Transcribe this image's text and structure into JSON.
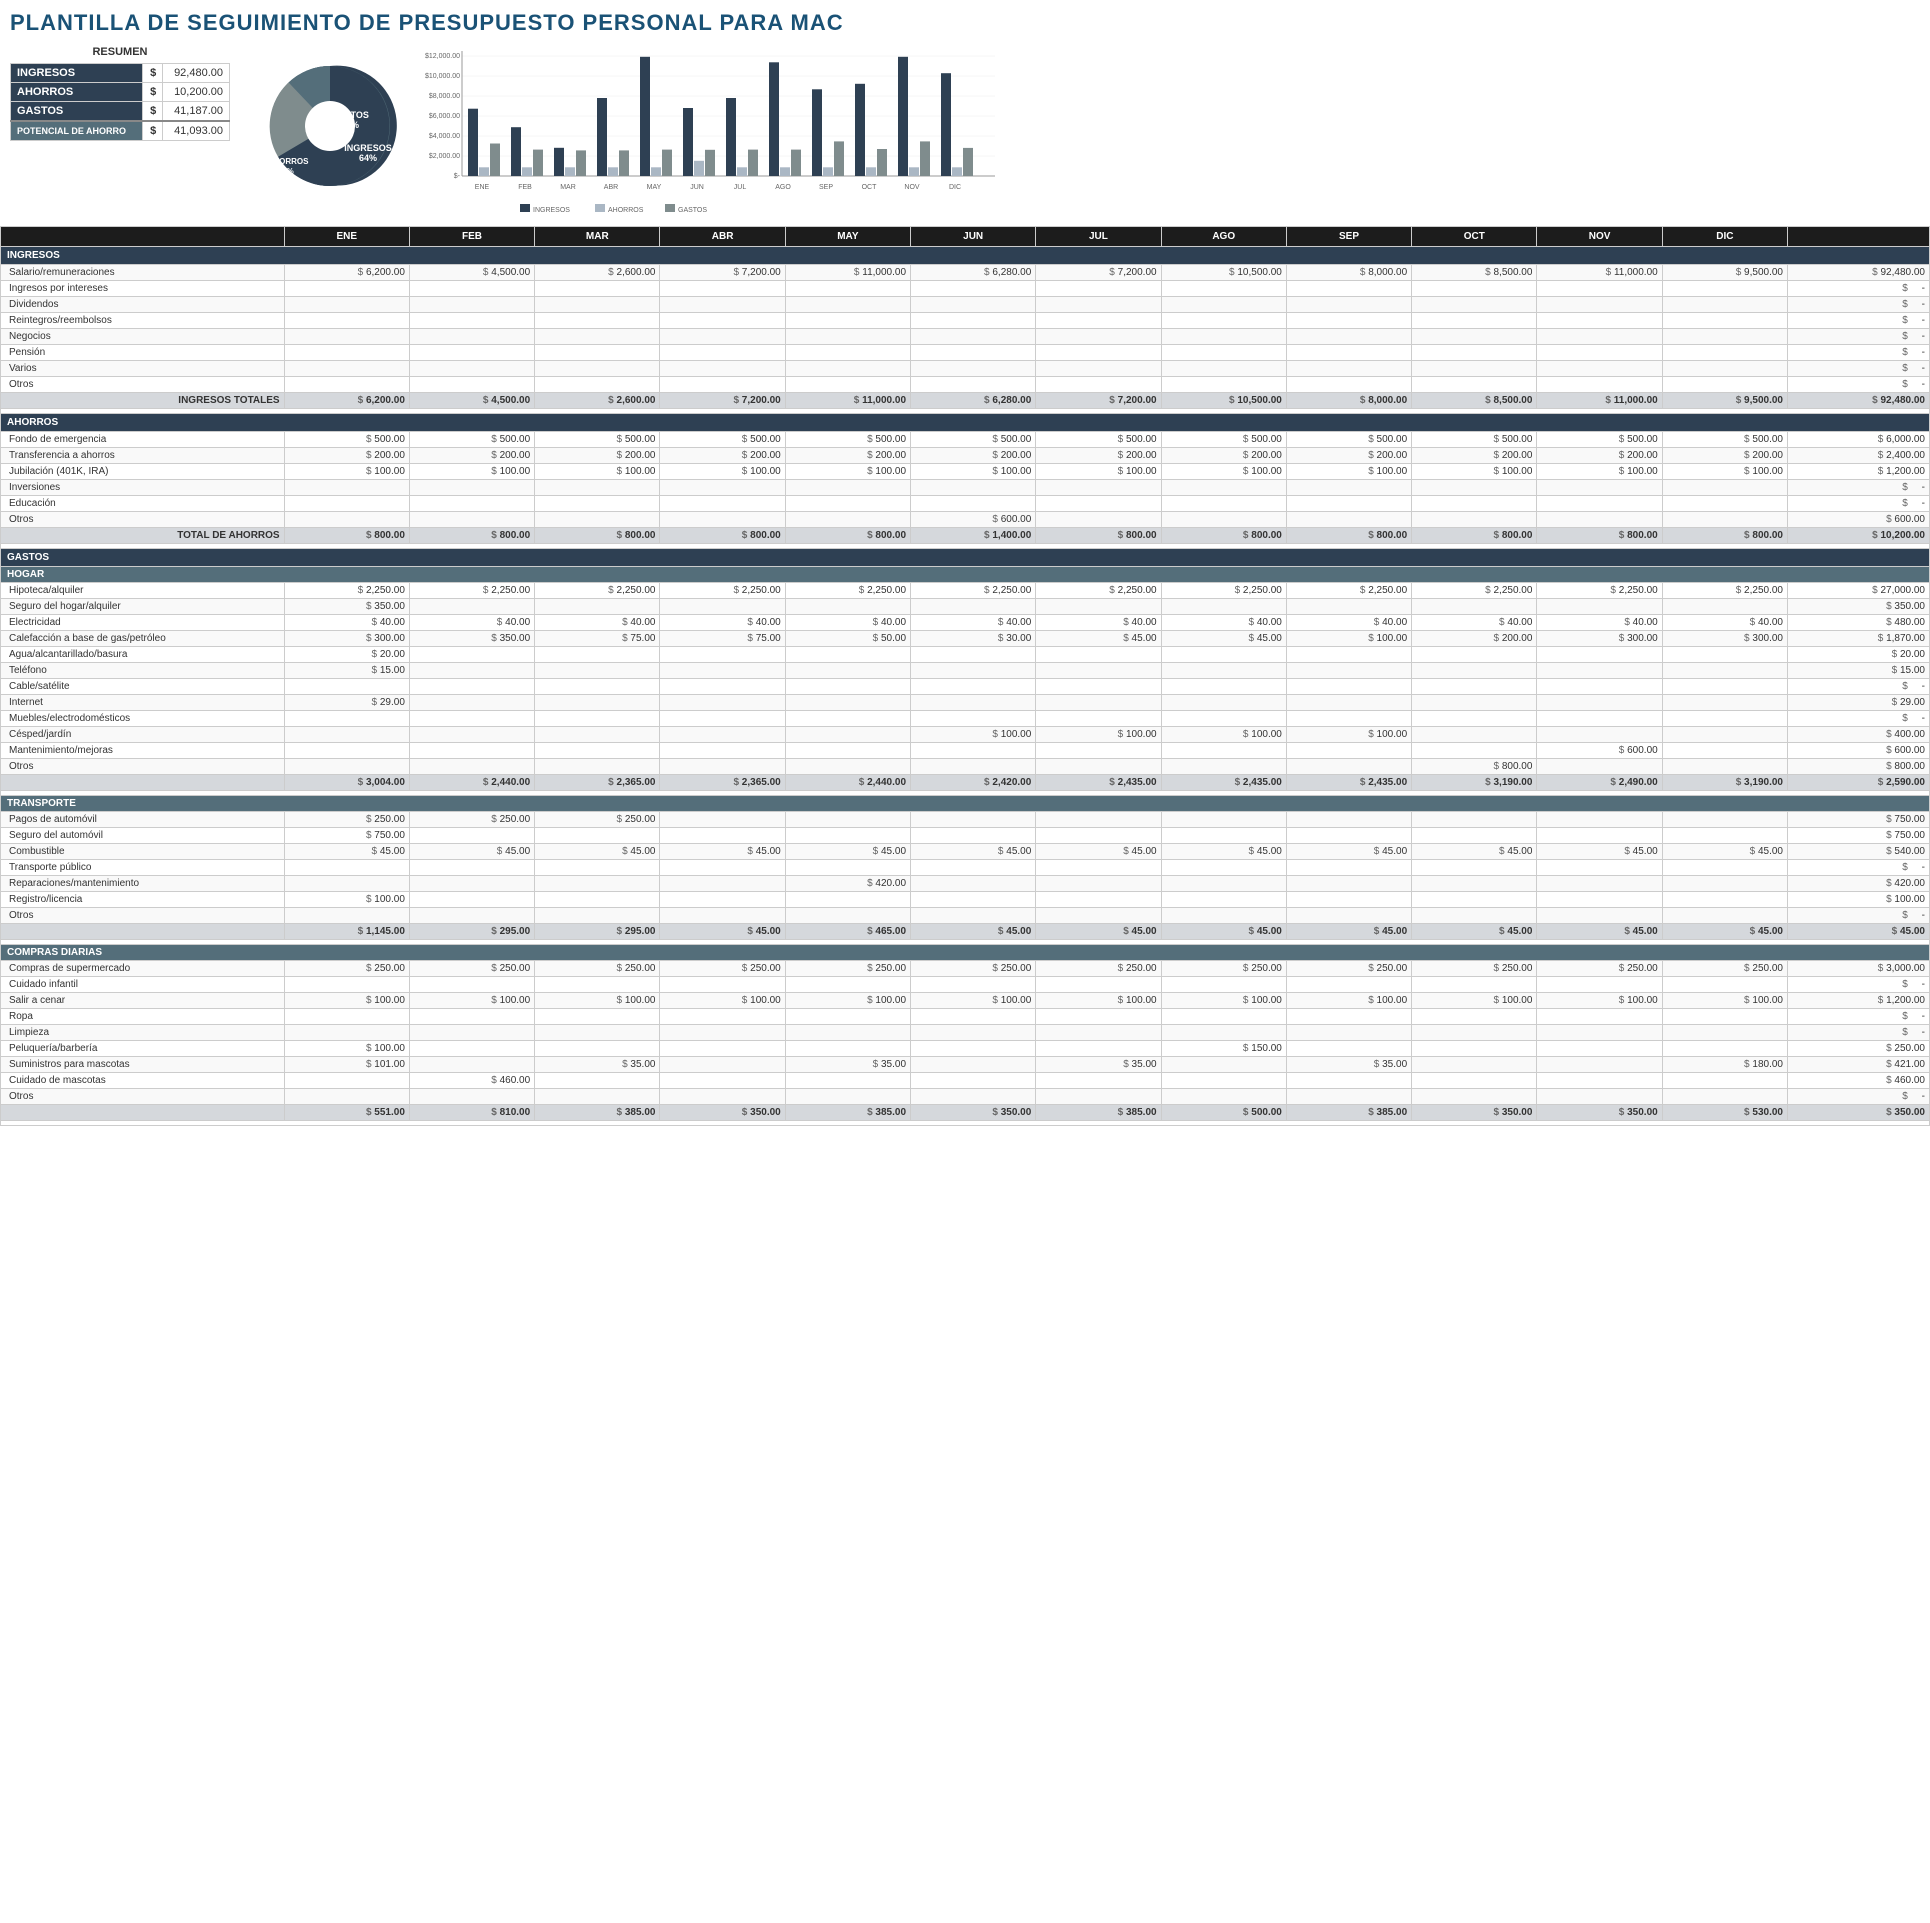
{
  "title": "PLANTILLA DE SEGUIMIENTO DE PRESUPUESTO PERSONAL PARA MAC",
  "resumen": {
    "title": "RESUMEN",
    "rows": [
      {
        "label": "INGRESOS",
        "symbol": "$",
        "value": "92,480.00"
      },
      {
        "label": "AHORROS",
        "symbol": "$",
        "value": "10,200.00"
      },
      {
        "label": "GASTOS",
        "symbol": "$",
        "value": "41,187.00"
      },
      {
        "label": "POTENCIAL DE AHORRO",
        "symbol": "$",
        "value": "41,093.00"
      }
    ]
  },
  "pie": {
    "gastos_pct": "29%",
    "ahorros_pct": "7%",
    "ingresos_pct": "64%"
  },
  "bar_chart": {
    "months": [
      "ENE",
      "FEB",
      "MAR",
      "ABR",
      "MAY",
      "JUN",
      "JUL",
      "AGO",
      "SEP",
      "OCT",
      "NOV",
      "DIC"
    ],
    "ingresos": [
      6200,
      4500,
      2600,
      7200,
      11000,
      6280,
      7200,
      10500,
      8000,
      8500,
      11000,
      9500
    ],
    "ahorros": [
      800,
      800,
      800,
      800,
      800,
      1400,
      800,
      800,
      800,
      800,
      800,
      800
    ],
    "gastos": [
      3004,
      2440,
      2365,
      2365,
      2440,
      2420,
      2435,
      2435,
      3190,
      2490,
      3190,
      2590
    ],
    "y_labels": [
      "$12,000.00",
      "$10,000.00",
      "$8,000.00",
      "$6,000.00",
      "$4,000.00",
      "$2,000.00",
      "$-"
    ],
    "legend": [
      "INGRESOS",
      "AHORROS",
      "GASTOS"
    ]
  },
  "months_header": [
    "ENE",
    "FEB",
    "MAR",
    "ABR",
    "MAY",
    "JUN",
    "JUL",
    "AGO",
    "SEP",
    "OCT",
    "NOV",
    "DIC"
  ],
  "sections": {
    "ingresos": {
      "title": "INGRESOS",
      "rows": [
        {
          "label": "Salario/remuneraciones",
          "values": [
            "6,200.00",
            "4,500.00",
            "2,600.00",
            "7,200.00",
            "11,000.00",
            "6,280.00",
            "7,200.00",
            "10,500.00",
            "8,000.00",
            "8,500.00",
            "11,000.00",
            "9,500.00"
          ],
          "total": "92,480.00"
        },
        {
          "label": "Ingresos por intereses",
          "values": [],
          "total": "-"
        },
        {
          "label": "Dividendos",
          "values": [],
          "total": "-"
        },
        {
          "label": "Reintegros/reembolsos",
          "values": [],
          "total": "-"
        },
        {
          "label": "Negocios",
          "values": [],
          "total": "-"
        },
        {
          "label": "Pensión",
          "values": [],
          "total": "-"
        },
        {
          "label": "Varios",
          "values": [],
          "total": "-"
        },
        {
          "label": "Otros",
          "values": [],
          "total": "-"
        }
      ],
      "total_label": "INGRESOS TOTALES",
      "total_values": [
        "6,200.00",
        "4,500.00",
        "2,600.00",
        "7,200.00",
        "11,000.00",
        "6,280.00",
        "7,200.00",
        "10,500.00",
        "8,000.00",
        "8,500.00",
        "11,000.00",
        "9,500.00"
      ],
      "total": "92,480.00"
    },
    "ahorros": {
      "title": "AHORROS",
      "rows": [
        {
          "label": "Fondo de emergencia",
          "values": [
            "500.00",
            "500.00",
            "500.00",
            "500.00",
            "500.00",
            "500.00",
            "500.00",
            "500.00",
            "500.00",
            "500.00",
            "500.00",
            "500.00"
          ],
          "total": "6,000.00"
        },
        {
          "label": "Transferencia a ahorros",
          "values": [
            "200.00",
            "200.00",
            "200.00",
            "200.00",
            "200.00",
            "200.00",
            "200.00",
            "200.00",
            "200.00",
            "200.00",
            "200.00",
            "200.00"
          ],
          "total": "2,400.00"
        },
        {
          "label": "Jubilación (401K, IRA)",
          "values": [
            "100.00",
            "100.00",
            "100.00",
            "100.00",
            "100.00",
            "100.00",
            "100.00",
            "100.00",
            "100.00",
            "100.00",
            "100.00",
            "100.00"
          ],
          "total": "1,200.00"
        },
        {
          "label": "Inversiones",
          "values": [],
          "total": "-"
        },
        {
          "label": "Educación",
          "values": [],
          "total": "-"
        },
        {
          "label": "Otros",
          "values": [
            "",
            "",
            "",
            "",
            "",
            "600.00",
            "",
            "",
            "",
            "",
            "",
            ""
          ],
          "total": "600.00"
        }
      ],
      "total_label": "TOTAL DE AHORROS",
      "total_values": [
        "800.00",
        "800.00",
        "800.00",
        "800.00",
        "800.00",
        "1,400.00",
        "800.00",
        "800.00",
        "800.00",
        "800.00",
        "800.00",
        "800.00"
      ],
      "total": "10,200.00"
    },
    "gastos": {
      "title": "GASTOS",
      "sub_sections": [
        {
          "title": "HOGAR",
          "rows": [
            {
              "label": "Hipoteca/alquiler",
              "values": [
                "2,250.00",
                "2,250.00",
                "2,250.00",
                "2,250.00",
                "2,250.00",
                "2,250.00",
                "2,250.00",
                "2,250.00",
                "2,250.00",
                "2,250.00",
                "2,250.00",
                "2,250.00"
              ],
              "total": "27,000.00"
            },
            {
              "label": "Seguro del hogar/alquiler",
              "values": [
                "350.00",
                "",
                "",
                "",
                "",
                "",
                "",
                "",
                "",
                "",
                "",
                ""
              ],
              "total": "350.00"
            },
            {
              "label": "Electricidad",
              "values": [
                "40.00",
                "40.00",
                "40.00",
                "40.00",
                "40.00",
                "40.00",
                "40.00",
                "40.00",
                "40.00",
                "40.00",
                "40.00",
                "40.00"
              ],
              "total": "480.00"
            },
            {
              "label": "Calefacción a base de gas/petróleo",
              "values": [
                "300.00",
                "350.00",
                "75.00",
                "75.00",
                "50.00",
                "30.00",
                "45.00",
                "45.00",
                "100.00",
                "200.00",
                "300.00",
                "300.00"
              ],
              "total": "1,870.00"
            },
            {
              "label": "Agua/alcantarillado/basura",
              "values": [
                "20.00",
                "",
                "",
                "",
                "",
                "",
                "",
                "",
                "",
                "",
                "",
                ""
              ],
              "total": "20.00"
            },
            {
              "label": "Teléfono",
              "values": [
                "15.00",
                "",
                "",
                "",
                "",
                "",
                "",
                "",
                "",
                "",
                "",
                ""
              ],
              "total": "15.00"
            },
            {
              "label": "Cable/satélite",
              "values": [],
              "total": "-"
            },
            {
              "label": "Internet",
              "values": [
                "29.00",
                "",
                "",
                "",
                "",
                "",
                "",
                "",
                "",
                "",
                "",
                ""
              ],
              "total": "29.00"
            },
            {
              "label": "Muebles/electrodomésticos",
              "values": [],
              "total": "-"
            },
            {
              "label": "Césped/jardín",
              "values": [
                "",
                "",
                "",
                "",
                "",
                "100.00",
                "100.00",
                "100.00",
                "100.00",
                "",
                "",
                ""
              ],
              "total": "400.00"
            },
            {
              "label": "Mantenimiento/mejoras",
              "values": [
                "",
                "",
                "",
                "",
                "",
                "",
                "",
                "",
                "",
                "",
                "600.00",
                ""
              ],
              "total": "600.00"
            },
            {
              "label": "Otros",
              "values": [
                "",
                "",
                "",
                "",
                "",
                "",
                "",
                "",
                "",
                "800.00",
                "",
                ""
              ],
              "total": "800.00"
            }
          ],
          "total_values": [
            "3,004.00",
            "2,440.00",
            "2,365.00",
            "2,365.00",
            "2,440.00",
            "2,420.00",
            "2,435.00",
            "2,435.00",
            "2,435.00",
            "3,190.00",
            "2,490.00",
            "3,190.00"
          ],
          "total": "2,590.00"
        },
        {
          "title": "TRANSPORTE",
          "rows": [
            {
              "label": "Pagos de automóvil",
              "values": [
                "250.00",
                "250.00",
                "250.00",
                "",
                "",
                "",
                "",
                "",
                "",
                "",
                "",
                ""
              ],
              "total": "750.00"
            },
            {
              "label": "Seguro del automóvil",
              "values": [
                "750.00",
                "",
                "",
                "",
                "",
                "",
                "",
                "",
                "",
                "",
                "",
                ""
              ],
              "total": "750.00"
            },
            {
              "label": "Combustible",
              "values": [
                "45.00",
                "45.00",
                "45.00",
                "45.00",
                "45.00",
                "45.00",
                "45.00",
                "45.00",
                "45.00",
                "45.00",
                "45.00",
                "45.00"
              ],
              "total": "540.00"
            },
            {
              "label": "Transporte público",
              "values": [],
              "total": "-"
            },
            {
              "label": "Reparaciones/mantenimiento",
              "values": [
                "",
                "",
                "",
                "",
                "420.00",
                "",
                "",
                "",
                "",
                "",
                "",
                ""
              ],
              "total": "420.00"
            },
            {
              "label": "Registro/licencia",
              "values": [
                "100.00",
                "",
                "",
                "",
                "",
                "",
                "",
                "",
                "",
                "",
                "",
                ""
              ],
              "total": "100.00"
            },
            {
              "label": "Otros",
              "values": [],
              "total": "-"
            }
          ],
          "total_values": [
            "1,145.00",
            "295.00",
            "295.00",
            "45.00",
            "465.00",
            "45.00",
            "45.00",
            "45.00",
            "45.00",
            "45.00",
            "45.00",
            "45.00"
          ],
          "total": "45.00"
        },
        {
          "title": "COMPRAS DIARIAS",
          "rows": [
            {
              "label": "Compras de supermercado",
              "values": [
                "250.00",
                "250.00",
                "250.00",
                "250.00",
                "250.00",
                "250.00",
                "250.00",
                "250.00",
                "250.00",
                "250.00",
                "250.00",
                "250.00"
              ],
              "total": "3,000.00"
            },
            {
              "label": "Cuidado infantil",
              "values": [],
              "total": "-"
            },
            {
              "label": "Salir a cenar",
              "values": [
                "100.00",
                "100.00",
                "100.00",
                "100.00",
                "100.00",
                "100.00",
                "100.00",
                "100.00",
                "100.00",
                "100.00",
                "100.00",
                "100.00"
              ],
              "total": "1,200.00"
            },
            {
              "label": "Ropa",
              "values": [],
              "total": "-"
            },
            {
              "label": "Limpieza",
              "values": [],
              "total": "-"
            },
            {
              "label": "Peluquería/barbería",
              "values": [
                "100.00",
                "",
                "",
                "",
                "",
                "",
                "",
                "150.00",
                "",
                "",
                "",
                ""
              ],
              "total": "250.00"
            },
            {
              "label": "Suministros para mascotas",
              "values": [
                "101.00",
                "",
                "35.00",
                "",
                "35.00",
                "",
                "35.00",
                "",
                "35.00",
                "",
                "",
                "180.00"
              ],
              "total": "421.00"
            },
            {
              "label": "Cuidado de mascotas",
              "values": [
                "",
                "460.00",
                "",
                "",
                "",
                "",
                "",
                "",
                "",
                "",
                "",
                ""
              ],
              "total": "460.00"
            },
            {
              "label": "Otros",
              "values": [],
              "total": "-"
            }
          ],
          "total_values": [
            "551.00",
            "810.00",
            "385.00",
            "350.00",
            "385.00",
            "350.00",
            "385.00",
            "500.00",
            "385.00",
            "350.00",
            "350.00",
            "530.00"
          ],
          "total": "350.00"
        }
      ]
    }
  }
}
